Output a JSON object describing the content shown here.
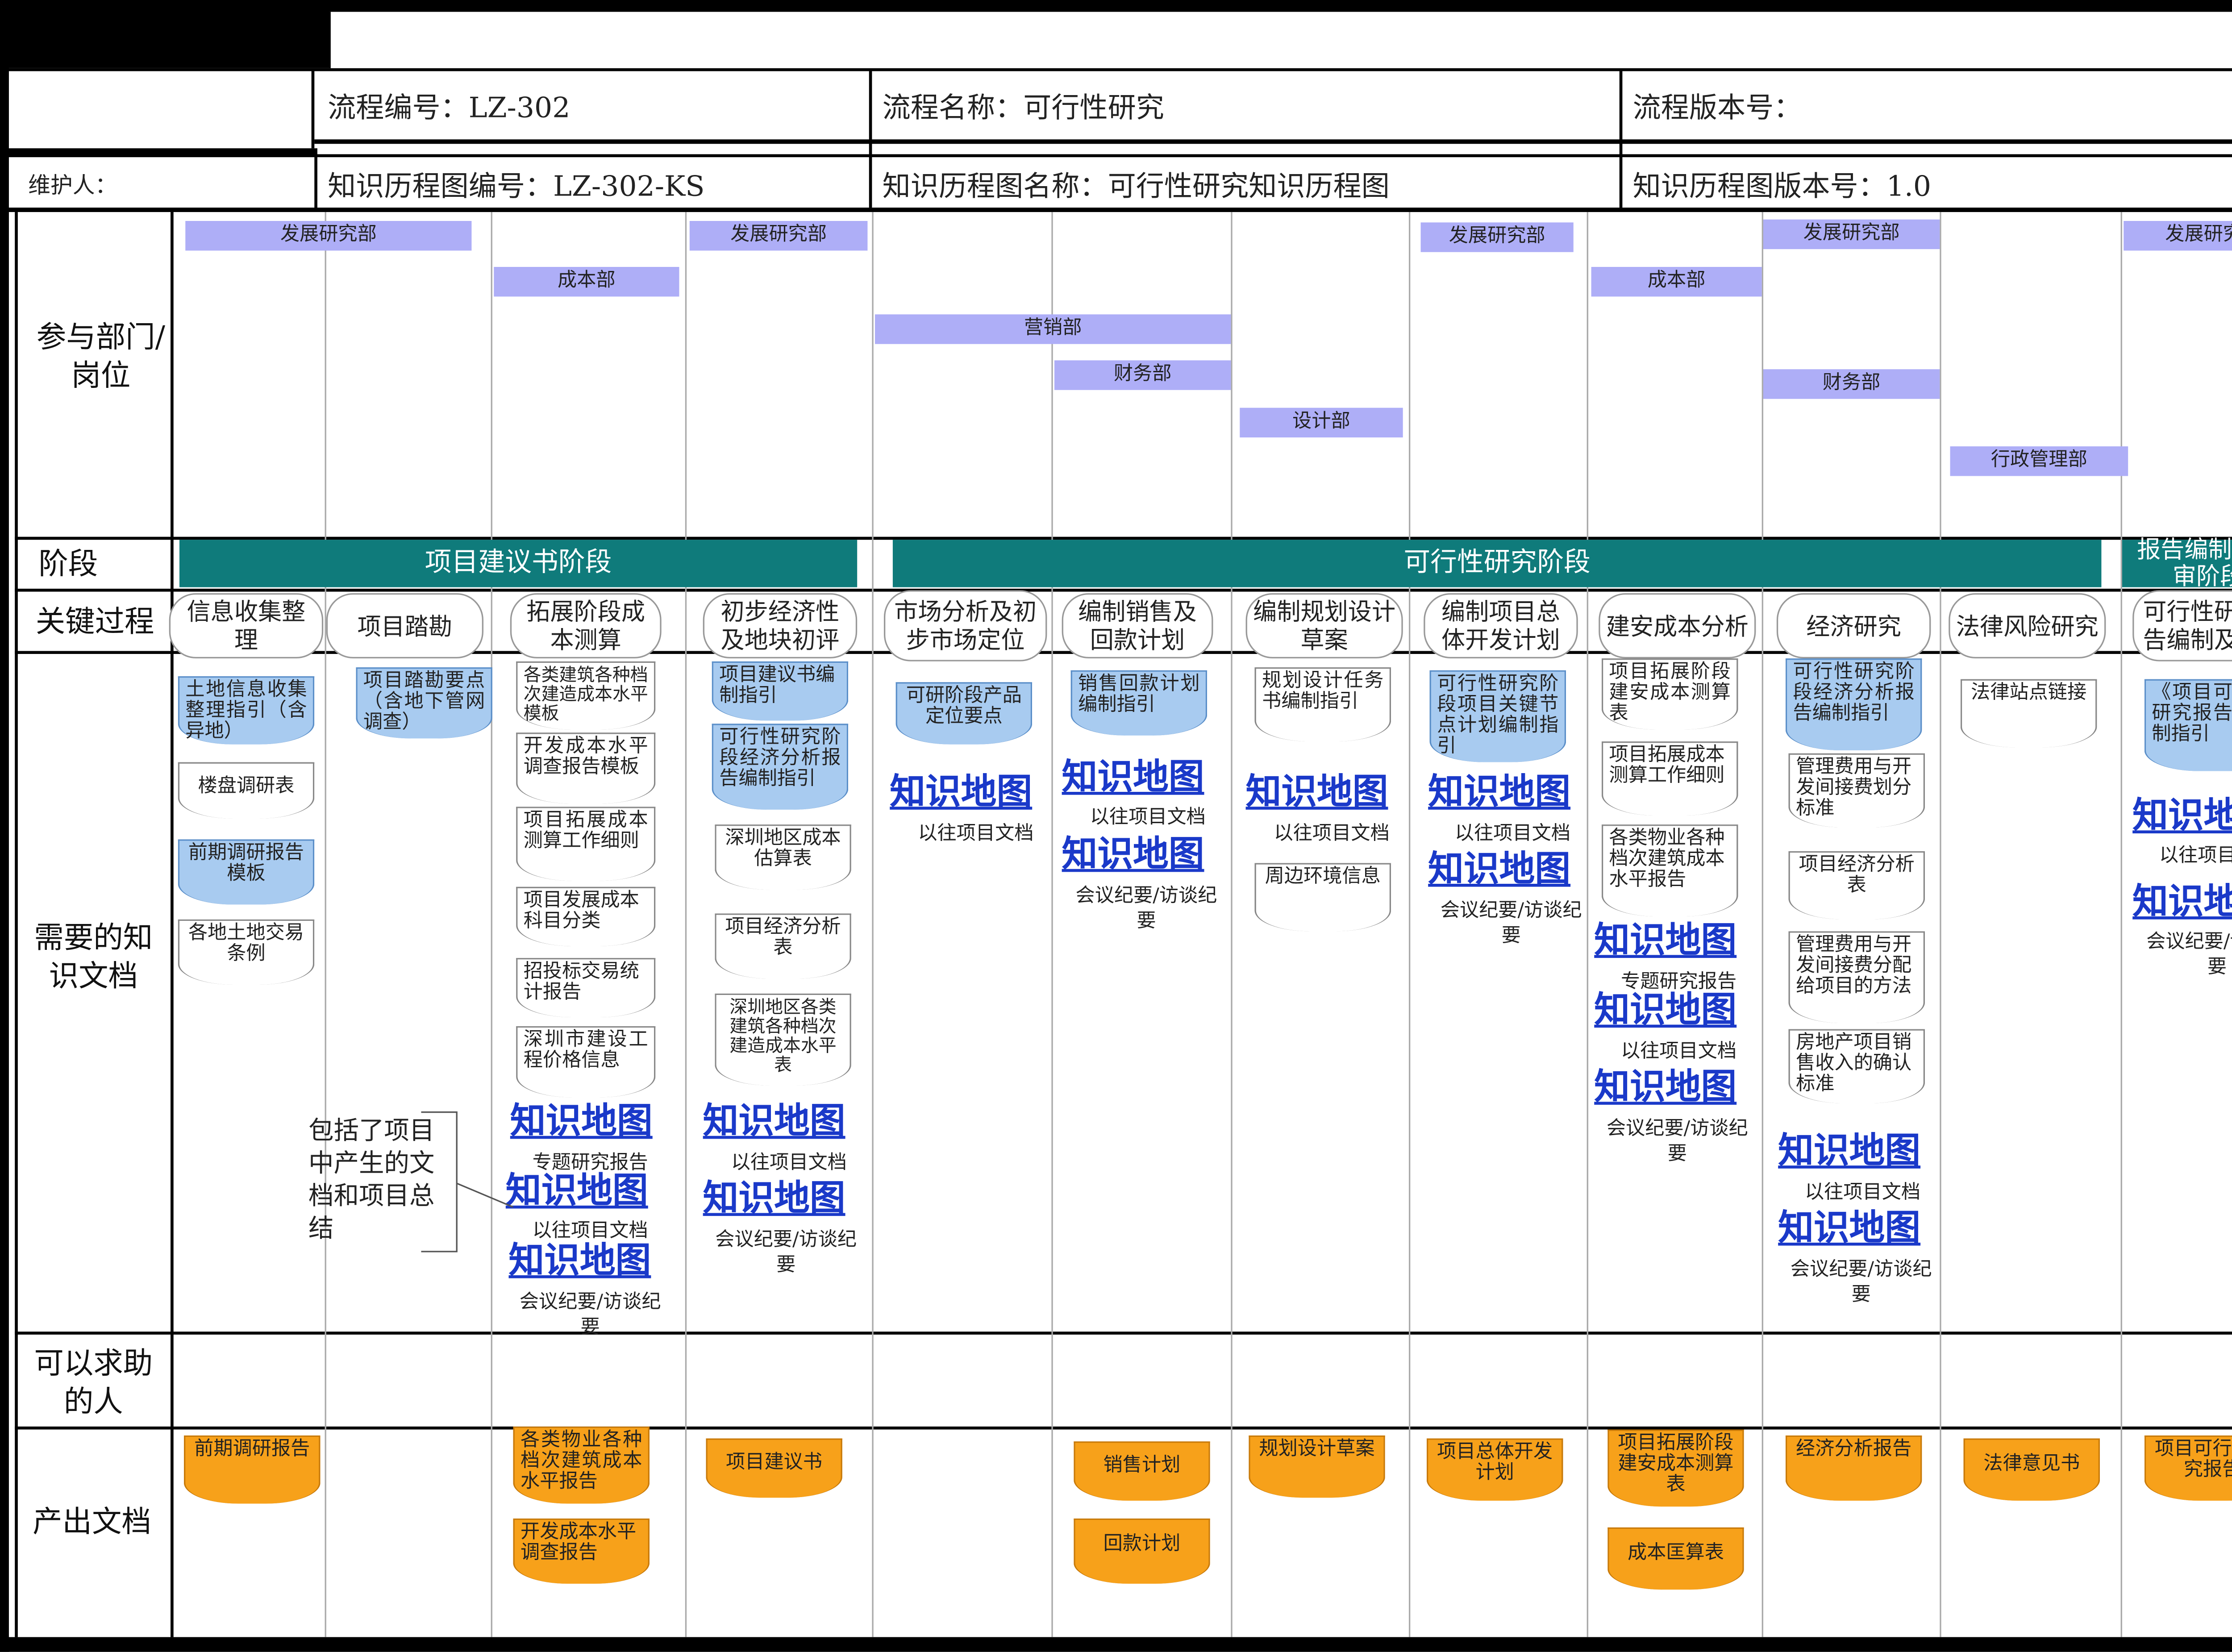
{
  "header": {
    "process_no": "流程编号：LZ-302",
    "process_name": "流程名称：可行性研究",
    "process_version": "流程版本号：",
    "maintainer": "维护人：",
    "km_no": "知识历程图编号：LZ-302-KS",
    "km_name": "知识历程图名称：可行性研究知识历程图",
    "km_version": "知识历程图版本号：1.0"
  },
  "row_labels": {
    "departments": "参与部门/岗位",
    "stage": "阶段",
    "key_process": "关键过程",
    "knowledge": "需要的知识文档",
    "helpers": "可以求助的人",
    "outputs": "产出文档"
  },
  "departments": [
    "发展研究部",
    "成本部",
    "发展研究部",
    "营销部",
    "财务部",
    "设计部",
    "发展研究部",
    "成本部",
    "发展研究部",
    "财务部",
    "行政管理部",
    "发展研究部"
  ],
  "stages": [
    "项目建议书阶段",
    "可行性研究阶段",
    "报告编制及评审阶段"
  ],
  "processes": [
    "信息收集整理",
    "项目踏勘",
    "拓展阶段成本测算",
    "初步经济性及地块初评",
    "市场分析及初步市场定位",
    "编制销售及回款计划",
    "编制规划设计草案",
    "编制项目总体开发计划",
    "建安成本分析",
    "经济研究",
    "法律风险研究",
    "可行性研究报告编制及评审"
  ],
  "knowledge_docs": [
    "土地信息收集整理指引（含异地）",
    "楼盘调研表",
    "前期调研报告模板",
    "各地土地交易条例",
    "项目踏勘要点（含地下管网调查）",
    "各类建筑各种档次建造成本水平模板",
    "开发成本水平调查报告模板",
    "项目拓展成本测算工作细则",
    "项目发展成本科目分类",
    "招投标交易统计报告",
    "深圳市建设工程价格信息",
    "项目建议书编制指引",
    "可行性研究阶段经济分析报告编制指引",
    "深圳地区成本估算表",
    "项目经济分析表",
    "深圳地区各类建筑各种档次建造成本水平表",
    "可研阶段产品定位要点",
    "销售回款计划编制指引",
    "规划设计任务书编制指引",
    "周边环境信息",
    "可行性研究阶段项目关键节点计划编制指引",
    "项目拓展阶段建安成本测算表",
    "项目拓展成本测算工作细则",
    "各类物业各种档次建筑成本水平报告",
    "可行性研究阶段经济分析报告编制指引",
    "管理费用与开发间接费划分标准",
    "项目经济分析表",
    "管理费用与开发间接费分配给项目的方法",
    "房地产项目销售收入的确认标准",
    "法律站点链接",
    "《项目可行性研究报告》编制指引"
  ],
  "km": {
    "link": "知识地图",
    "special": "专题研究报告",
    "past": "以往项目文档",
    "minutes": "会议纪要/访谈纪要",
    "note": "包括了项目中产生的文档和项目总结"
  },
  "outputs": [
    "前期调研报告",
    "各类物业各种档次建筑成本水平报告",
    "开发成本水平调查报告",
    "项目建议书",
    "销售计划",
    "回款计划",
    "规划设计草案",
    "项目总体开发计划",
    "项目拓展阶段建安成本测算表",
    "成本匡算表",
    "经济分析报告",
    "法律意见书",
    "项目可行性研究报告"
  ],
  "colors": {
    "dept": "#aeaef7",
    "stage": "#0f7b7b",
    "doc_blue": "#a8cbf0",
    "doc_orange": "#f7a11a",
    "link": "#1a39c9"
  }
}
